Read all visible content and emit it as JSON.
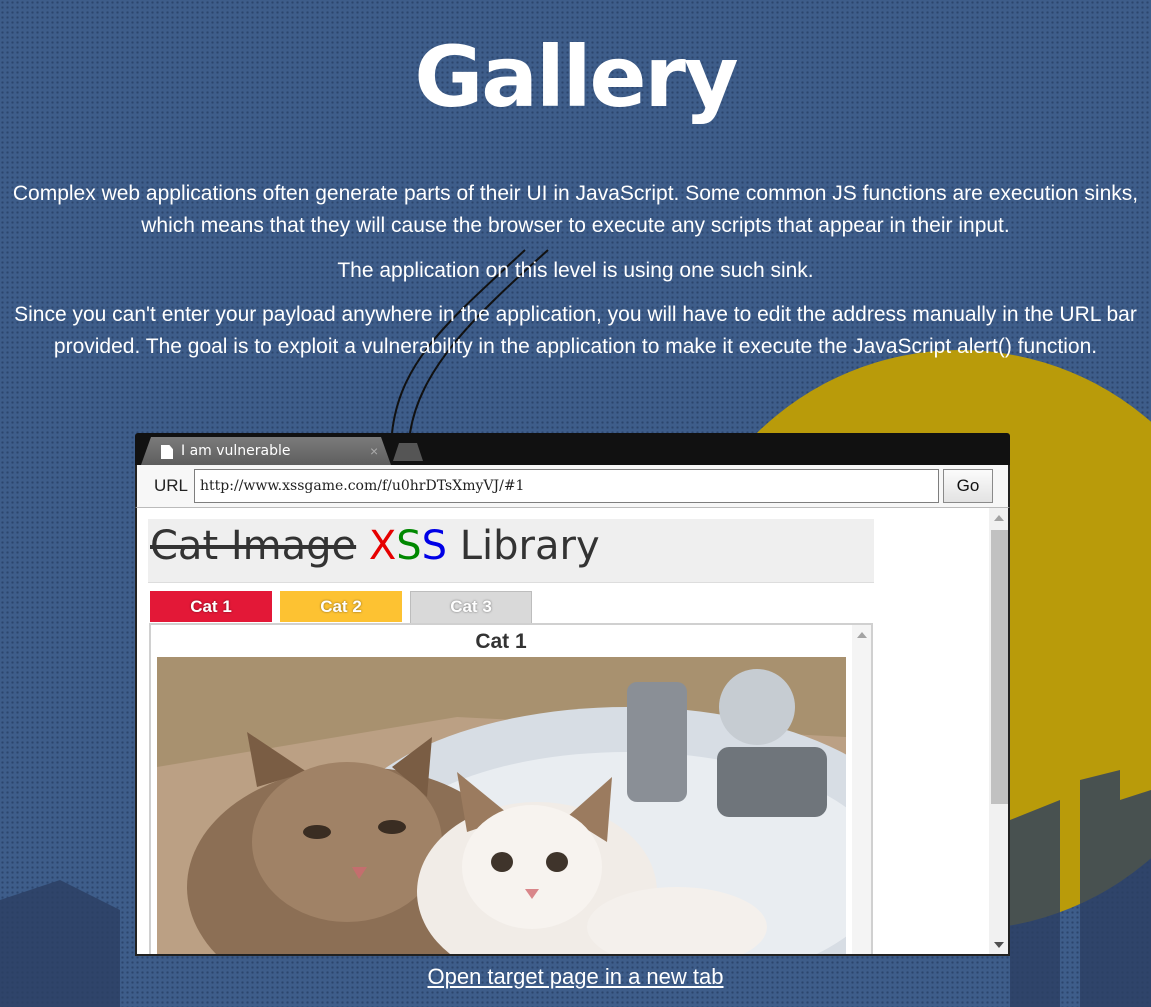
{
  "page": {
    "title": "Gallery",
    "paragraphs": [
      "Complex web applications often generate parts of their UI in JavaScript. Some common JS functions are execution sinks, which means that they will cause the browser to execute any scripts that appear in their input.",
      "The application on this level is using one such sink.",
      "Since you can't enter your payload anywhere in the application, you will have to edit the address manually in the URL bar provided. The goal is to exploit a vulnerability in the application to make it execute the JavaScript alert() function."
    ],
    "open_link": "Open target page in a new tab"
  },
  "browser": {
    "tab_title": "I am vulnerable",
    "tab_close": "×",
    "url_label": "URL",
    "url_value": "http://www.xssgame.com/f/u0hrDTsXmyVJ/#1",
    "go_label": "Go"
  },
  "app": {
    "header_strike": "Cat Image",
    "header_x": "X",
    "header_s1": "S",
    "header_s2": "S",
    "header_rest": "Library",
    "tabs": [
      "Cat 1",
      "Cat 2",
      "Cat 3"
    ],
    "panel_title": "Cat 1"
  },
  "colors": {
    "background": "#3e5d8a",
    "sun": "#c9a200",
    "tab1": "#e31837",
    "tab2": "#fdc232",
    "tab3": "#d9d9d9"
  }
}
